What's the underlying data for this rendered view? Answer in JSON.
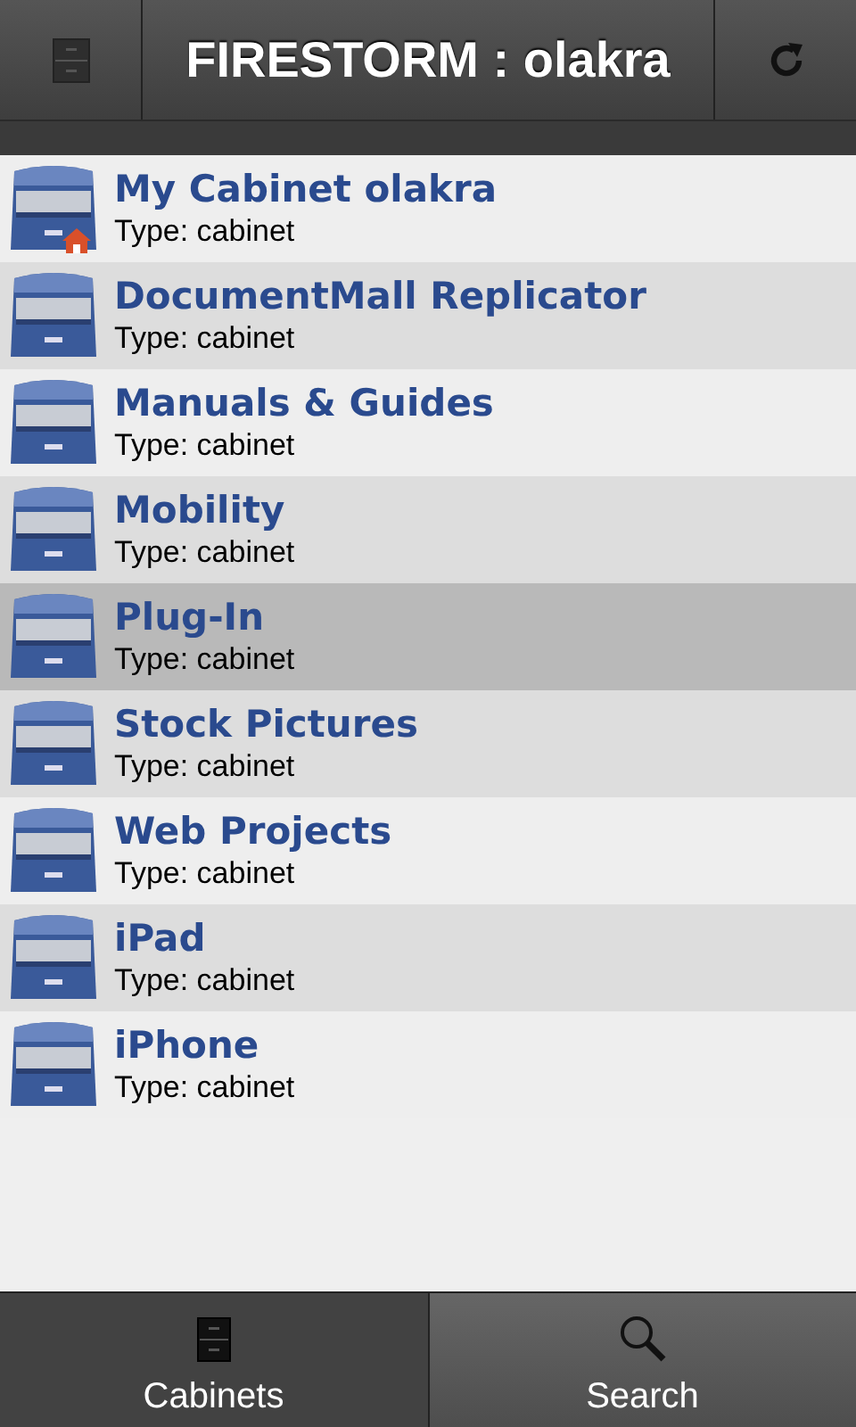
{
  "header": {
    "title": "FIRESTORM : olakra"
  },
  "items": [
    {
      "name": "My Cabinet olakra",
      "type": "Type: cabinet",
      "home": true,
      "selected": false
    },
    {
      "name": "DocumentMall Replicator",
      "type": "Type: cabinet",
      "home": false,
      "selected": false
    },
    {
      "name": "Manuals & Guides",
      "type": "Type: cabinet",
      "home": false,
      "selected": false
    },
    {
      "name": "Mobility",
      "type": "Type: cabinet",
      "home": false,
      "selected": false
    },
    {
      "name": "Plug-In",
      "type": "Type: cabinet",
      "home": false,
      "selected": true
    },
    {
      "name": "Stock Pictures",
      "type": "Type: cabinet",
      "home": false,
      "selected": false
    },
    {
      "name": "Web Projects",
      "type": "Type: cabinet",
      "home": false,
      "selected": false
    },
    {
      "name": "iPad",
      "type": "Type: cabinet",
      "home": false,
      "selected": false
    },
    {
      "name": "iPhone",
      "type": "Type: cabinet",
      "home": false,
      "selected": false
    }
  ],
  "tabs": [
    {
      "label": "Cabinets",
      "kind": "cabinets",
      "selected": true
    },
    {
      "label": "Search",
      "kind": "search",
      "selected": false
    }
  ]
}
